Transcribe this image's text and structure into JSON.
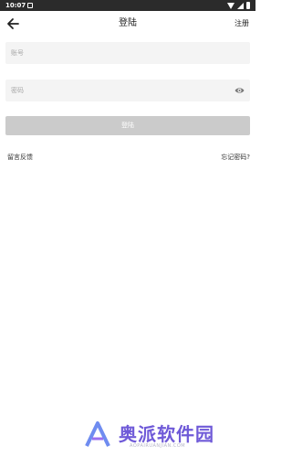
{
  "status_bar": {
    "time": "10:07"
  },
  "nav": {
    "title": "登陆",
    "register_label": "注册",
    "back_icon": "arrow-left-icon"
  },
  "form": {
    "account_placeholder": "账号",
    "password_placeholder": "密码",
    "eye_icon": "eye-icon",
    "login_label": "登陆"
  },
  "links": {
    "feedback": "留言反馈",
    "forgot_password": "忘记密码?"
  },
  "watermark": {
    "text": "奥派软件园",
    "sub": "AOPAIRUANJIAN.COM"
  },
  "colors": {
    "status_bar": "#2b2b2b",
    "field_bg": "#f4f4f4",
    "button_bg": "#cbcbcb",
    "watermark": "#6f5ad8"
  }
}
